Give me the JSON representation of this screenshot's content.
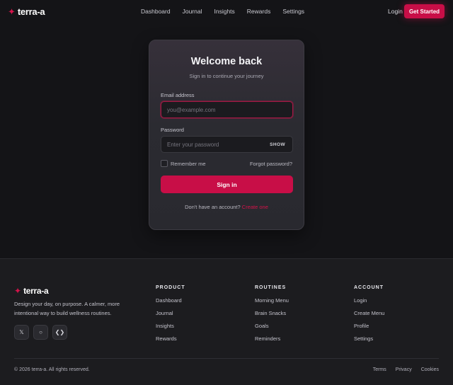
{
  "brand": {
    "name": "terra-a",
    "star": "✦"
  },
  "nav": {
    "items": [
      "Dashboard",
      "Journal",
      "Insights",
      "Rewards",
      "Settings"
    ]
  },
  "header": {
    "login_label": "Login",
    "cta_label": "Get Started"
  },
  "login_card": {
    "title": "Welcome back",
    "subtitle": "Sign in to continue your journey",
    "email_label": "Email address",
    "email_placeholder": "you@example.com",
    "password_label": "Password",
    "password_placeholder": "Enter your password",
    "show_label": "SHOW",
    "remember_label": "Remember me",
    "forgot_label": "Forgot password?",
    "signin_label": "Sign in",
    "no_account_text": "Don't have an account?",
    "create_label": "Create one"
  },
  "footer": {
    "description": "Design your day, on purpose. A calmer, more intentional way to build wellness routines.",
    "socials": [
      {
        "icon": "x-icon",
        "glyph": "𝕏"
      },
      {
        "icon": "circle-icon",
        "glyph": "○"
      },
      {
        "icon": "code-icon",
        "glyph": "❮❯"
      }
    ],
    "columns": [
      {
        "title": "PRODUCT",
        "links": [
          "Dashboard",
          "Journal",
          "Insights",
          "Rewards"
        ]
      },
      {
        "title": "ROUTINES",
        "links": [
          "Morning Menu",
          "Brain Snacks",
          "Goals",
          "Reminders"
        ]
      },
      {
        "title": "ACCOUNT",
        "links": [
          "Login",
          "Create Menu",
          "Profile",
          "Settings"
        ]
      }
    ],
    "copyright": "© 2026 terra-a. All rights reserved.",
    "legal": [
      "Terms",
      "Privacy",
      "Cookies"
    ]
  },
  "colors": {
    "accent": "#c80e47",
    "background": "#141417",
    "card": "#2b2b31",
    "footer": "#1c1c1f"
  }
}
